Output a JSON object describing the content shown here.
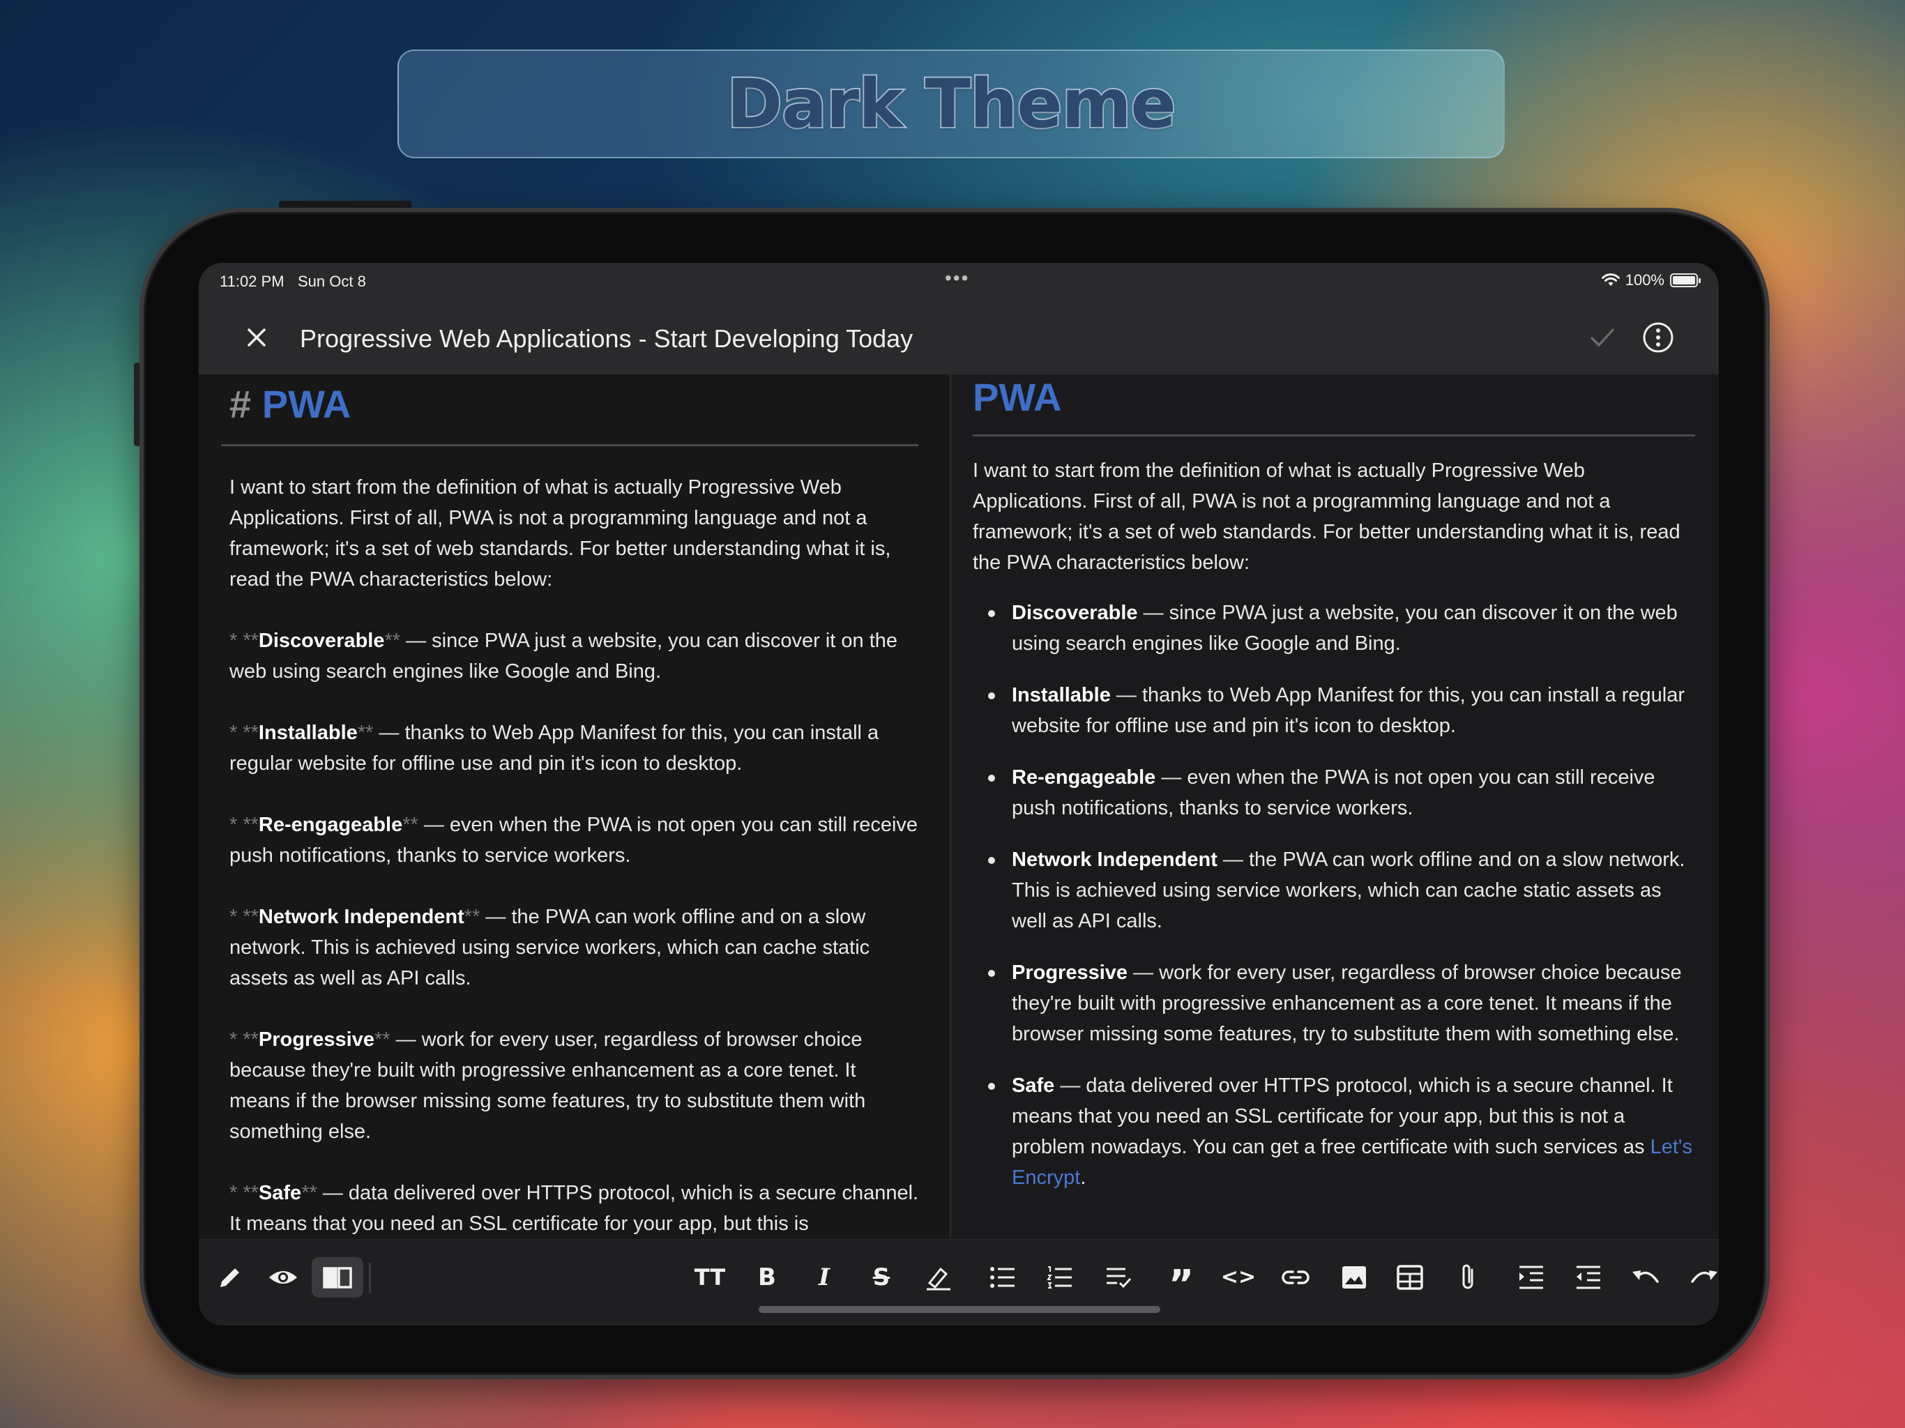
{
  "banner": {
    "title": "Dark Theme"
  },
  "status": {
    "time": "11:02 PM",
    "date": "Sun Oct 8",
    "battery": "100%",
    "battery_level": 1.0
  },
  "header": {
    "title": "Progressive Web Applications - Start Developing Today"
  },
  "editor": {
    "heading_marker": "#",
    "heading": "PWA",
    "intro": "I want to start from the definition of what is actually Progressive Web Applications. First of all, PWA is not a programming language and not a framework; it's a set of web standards. For better understanding what it is, read the PWA characteristics below:",
    "list_marker": "* **",
    "bold_close": "**",
    "items": [
      {
        "term": "Discoverable",
        "text": " — since PWA just a website, you can discover it on the web using search engines like Google and Bing."
      },
      {
        "term": "Installable",
        "text": " — thanks to Web App Manifest for this, you can install a regular website for offline use and pin it's icon to desktop."
      },
      {
        "term": "Re-engageable",
        "text": " — even when the PWA is not open you can still receive push notifications, thanks to service workers."
      },
      {
        "term": "Network Independent",
        "text": " — the PWA can work offline and on a slow network. This is achieved using service workers, which can cache static assets as well as API calls."
      },
      {
        "term": "Progressive",
        "text": " — work for every user, regardless of browser choice because they're built with progressive enhancement as a core tenet. It means if the browser missing some features, try to substitute them with something else."
      },
      {
        "term": "Safe",
        "text": " — data delivered over HTTPS protocol, which is a secure channel. It means that you need an SSL certificate for your app, but this is"
      }
    ]
  },
  "preview": {
    "heading": "PWA",
    "intro": "I want to start from the definition of what is actually Progressive Web Applications. First of all, PWA is not a programming language and not a framework; it's a set of web standards. For better understanding what it is, read the PWA characteristics below:",
    "items": [
      {
        "term": "Discoverable",
        "text": " — since PWA just a website, you can discover it on the web using search engines like Google and Bing."
      },
      {
        "term": "Installable",
        "text": " — thanks to Web App Manifest for this, you can install a regular website for offline use and pin it's icon to desktop."
      },
      {
        "term": "Re-engageable",
        "text": " — even when the PWA is not open you can still receive push notifications, thanks to service workers."
      },
      {
        "term": "Network Independent",
        "text": " — the PWA can work offline and on a slow network. This is achieved using service workers, which can cache static assets as well as API calls."
      },
      {
        "term": "Progressive",
        "text": " — work for every user, regardless of browser choice because they're built with progressive enhancement as a core tenet. It means if the browser missing some features, try to substitute them with something else."
      }
    ],
    "safe_term": "Safe",
    "safe_text": " — data delivered over HTTPS protocol, which is a secure channel. It means that you need an SSL certificate for your app, but this is not a problem nowadays. You can get a free certificate with such services as ",
    "safe_link": "Let's Encrypt",
    "safe_end": "."
  },
  "toolbar": {
    "heading_glyph": "TT",
    "bold_glyph": "B",
    "italic_glyph": "I",
    "strike_glyph": "S",
    "quote_glyph": "”",
    "code_glyph": "<>",
    "icons": [
      "pencil-icon",
      "eye-icon",
      "book-icon",
      "text-size-icon",
      "bold-icon",
      "italic-icon",
      "strikethrough-icon",
      "highlighter-icon",
      "bulleted-list-icon",
      "numbered-list-icon",
      "checklist-icon",
      "quote-icon",
      "code-icon",
      "link-icon",
      "image-icon",
      "table-icon",
      "attachment-icon",
      "indent-icon",
      "outdent-icon",
      "undo-icon",
      "redo-icon",
      "search-icon",
      "keyboard-hide-icon",
      "info-icon"
    ]
  },
  "colors": {
    "accent": "#3f6ec8",
    "link": "#4b79d0",
    "background": "#161617",
    "bar": "#2a2a2c"
  }
}
